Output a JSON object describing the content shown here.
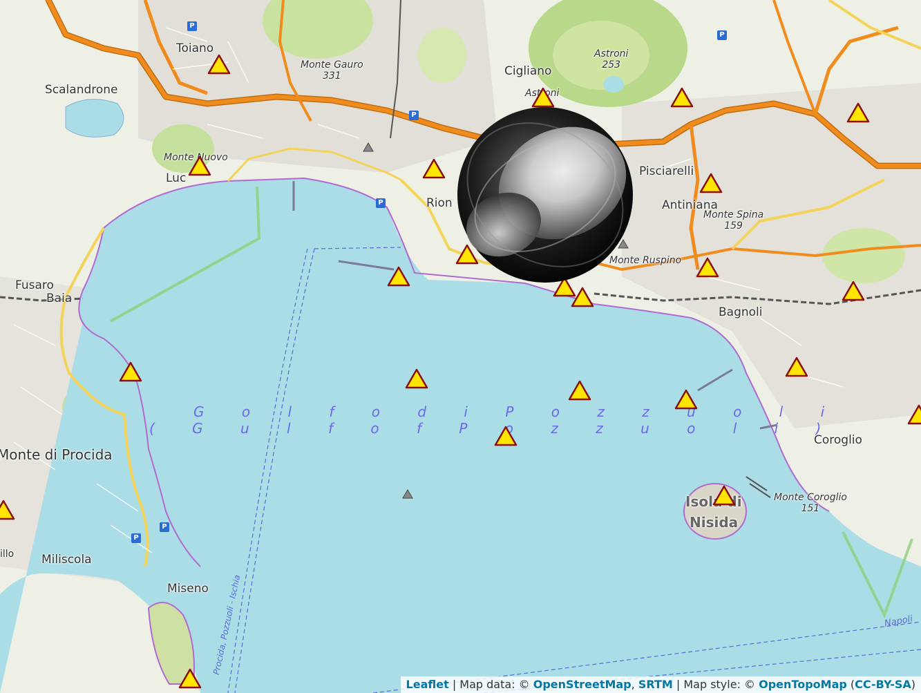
{
  "map": {
    "colors": {
      "water": "#aadde6",
      "land": "#eef0e6",
      "road_major": "#f08c1e",
      "road_minor": "#f3d35a",
      "marker_fill": "#ffe500",
      "marker_stroke": "#8a1010",
      "ferry": "#5a6ad8"
    },
    "labels": {
      "toiano": "Toiano",
      "scalandrone": "Scalandrone",
      "monte_gauro_name": "Monte Gauro",
      "monte_gauro_elev": "331",
      "cigliano": "Cigliano",
      "astroni_name": "Astroni",
      "astroni_elev": "253",
      "astroni_road": "Astroni",
      "monte_nuovo": "Monte Nuovo",
      "lucrino": "Luc",
      "rione": "Rion",
      "pisciarelli": "Pisciarelli",
      "antiniana": "Antiniana",
      "monte_spina_name": "Monte Spina",
      "monte_spina_elev": "159",
      "monte_ruspino": "Monte Ruspino",
      "fusaro": "Fusaro",
      "baia": "Baia",
      "bagnoli": "Bagnoli",
      "golfo_it": "G o l f o   d i   P o z z u o l i",
      "golfo_en": "( G u l f   o f   P o z z u o l i )",
      "monte_di_procida": "Monte di Procida",
      "coroglio": "Coroglio",
      "isola_di_nisida_1": "Isola di",
      "isola_di_nisida_2": "Nisida",
      "monte_coroglio_name": "Monte Coroglio",
      "monte_coroglio_elev": "151",
      "miliscola": "Miliscola",
      "miseno": "Miseno",
      "ferry_route": "Procida, Pozzuoli - Ischia",
      "napoli_fragment": "Napoli",
      "illo_fragment": "illo"
    },
    "icons": [
      "warning-triangle-marker",
      "peak-icon",
      "parking-icon",
      "globe-marker"
    ]
  },
  "attribution": {
    "leaflet": "Leaflet",
    "sep1": " | Map data: © ",
    "osm": "OpenStreetMap",
    "comma": ", ",
    "srtm": "SRTM",
    "sep2": " | Map style: © ",
    "otm": "OpenTopoMap",
    "paren_open": " (",
    "license": "CC-BY-SA",
    "paren_close": ")"
  }
}
